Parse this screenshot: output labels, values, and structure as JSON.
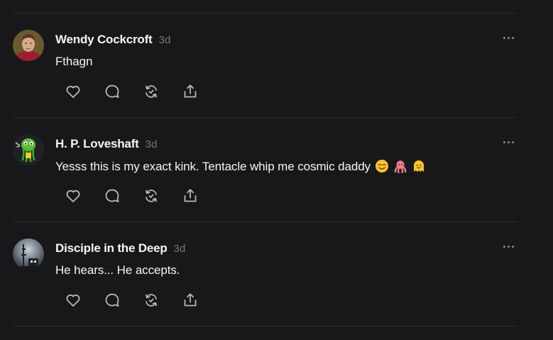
{
  "posts": [
    {
      "author": "Wendy Cockcroft",
      "time": "3d",
      "text": "Fthagn",
      "emojis": []
    },
    {
      "author": "H. P. Loveshaft",
      "time": "3d",
      "text": "Yesss this is my exact kink. Tentacle whip me cosmic daddy",
      "emojis": [
        "smiling-face-with-smiling-eyes",
        "octopus",
        "smiling-ghost"
      ]
    },
    {
      "author": "Disciple in the Deep",
      "time": "3d",
      "text": "He hears... He accepts.",
      "emojis": []
    }
  ],
  "actions": [
    "heart-icon",
    "comment-icon",
    "repost-icon",
    "share-icon"
  ],
  "colors": {
    "background": "#18181b",
    "divider": "#2d2d31",
    "text": "#f3f5f7",
    "muted": "#777777",
    "icon": "#b8b8b8"
  }
}
